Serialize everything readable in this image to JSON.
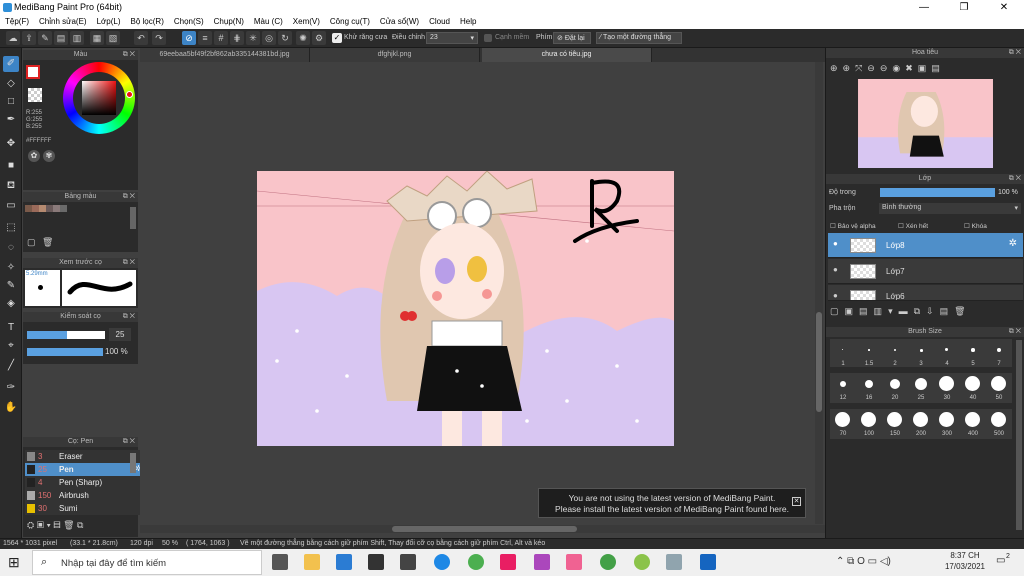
{
  "window": {
    "title": "MediBang Paint Pro (64bit)",
    "min": "—",
    "max": "❐",
    "close": "✕"
  },
  "menu": [
    "Tệp(F)",
    "Chỉnh sửa(E)",
    "Lớp(L)",
    "Bộ lọc(R)",
    "Chọn(S)",
    "Chụp(N)",
    "Màu (C)",
    "Xem(V)",
    "Công cụ(T)",
    "Cửa sổ(W)",
    "Cloud",
    "Help"
  ],
  "toolbar": {
    "antialias_label": "Khử răng cưa",
    "adjust_label": "Điều chỉnh",
    "adjust_value": "23",
    "margin_label": "Cạnh mềm",
    "key_label": "Phím",
    "undo_label": "Đặt lại",
    "create_line_label": "Tạo một đường thẳng"
  },
  "tabs": [
    "69eebaa5bf49f2bf862ab335144381bd.jpg",
    "dfghjkl.png",
    "chưa có tiêu.jpg"
  ],
  "color_panel": {
    "title": "Màu",
    "r": "R:255",
    "g": "G:255",
    "b": "B:255",
    "hex": "#FFFFFF"
  },
  "palette_panel": {
    "title": "Bảng màu"
  },
  "brush_preview_panel": {
    "title": "Xem trước cọ",
    "size": "5.29mm"
  },
  "brush_control_panel": {
    "title": "Kiểm soát cọ",
    "size_value": "25",
    "opacity_value": "100 %"
  },
  "brush_list_panel": {
    "title": "Cọ: Pen",
    "items": [
      {
        "size": "3",
        "name": "Eraser",
        "color": "#888888"
      },
      {
        "size": "25",
        "name": "Pen",
        "color": "#222222"
      },
      {
        "size": "4",
        "name": "Pen (Sharp)",
        "color": "#222222"
      },
      {
        "size": "150",
        "name": "Airbrush",
        "color": "#aaaaaa"
      },
      {
        "size": "30",
        "name": "Sumi",
        "color": "#e8c000"
      }
    ]
  },
  "navigator_panel": {
    "title": "Hoa tiêu"
  },
  "layer_panel": {
    "title": "Lớp",
    "opacity_label": "Độ trong",
    "opacity_value": "100 %",
    "blend_label": "Pha trộn",
    "blend_value": "Bình thường",
    "protect_alpha": "Bảo vệ alpha",
    "clipping": "Xén hết",
    "lock": "Khóa",
    "layers": [
      "Lớp8",
      "Lớp7",
      "Lớp6"
    ]
  },
  "brush_size_panel": {
    "title": "Brush Size",
    "rows": [
      [
        "1",
        "1.5",
        "2",
        "3",
        "4",
        "5",
        "7"
      ],
      [
        "12",
        "16",
        "20",
        "25",
        "30",
        "40",
        "50"
      ],
      [
        "70",
        "100",
        "150",
        "200",
        "300",
        "400",
        "500"
      ]
    ]
  },
  "canvas_signature": "R",
  "notification": {
    "line1": "You are not using the latest version of MediBang Paint.",
    "line2": "Please install the latest version of MediBang Paint found here.",
    "close": "✕"
  },
  "status": {
    "dims": "1564 * 1031 pixel",
    "cm": "(33.1 * 21.8cm)",
    "dpi": "120 dpi",
    "zoom": "50 %",
    "coords": "( 1764, 1063 )",
    "hint": "Vẽ một đường thẳng bằng cách giữ phím Shift, Thay đổi cỡ cọ bằng cách giữ phím Ctrl, Alt và kéo"
  },
  "taskbar": {
    "search_placeholder": "Nhập tại đây để tìm kiếm",
    "time": "8:37 CH",
    "date": "17/03/2021",
    "notif_count": "2"
  },
  "colors": {
    "accent": "#3d84c6",
    "canvas_pink": "#f9c4c9",
    "canvas_purple": "#d8c6f2"
  }
}
